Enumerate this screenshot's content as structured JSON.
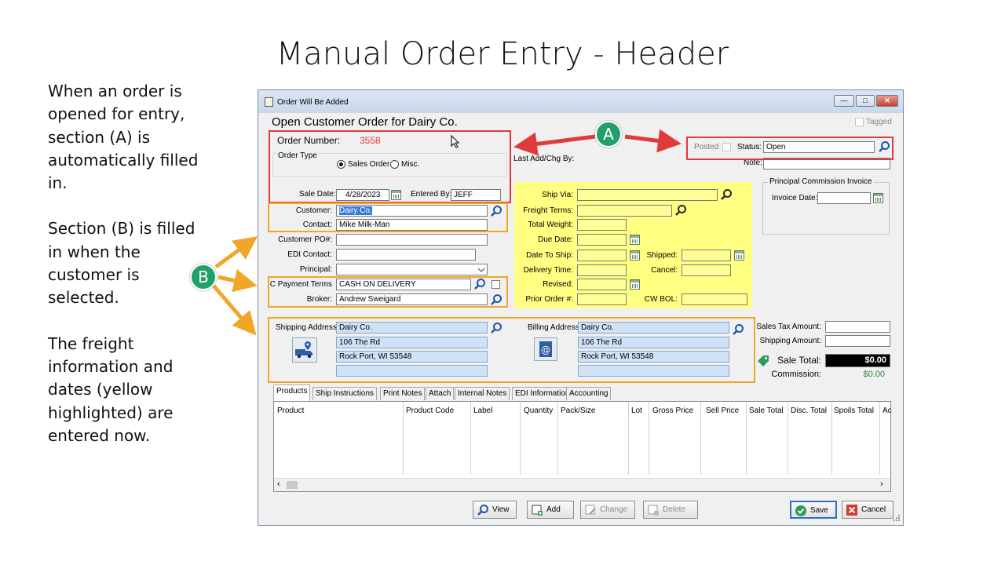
{
  "slide": {
    "title": "Manual Order Entry - Header",
    "paragraphs": [
      "When an order is opened for entry, section (A) is automatically filled in.",
      "Section (B) is filled in when the customer is selected.",
      "The freight information and dates (yellow highlighted) are entered now."
    ]
  },
  "callouts": {
    "a": "A",
    "b": "B"
  },
  "window": {
    "title": "Order Will Be Added",
    "heading": "Open Customer Order for Dairy Co.",
    "tagged_label": "Tagged",
    "order_number_label": "Order Number:",
    "order_number": "3558",
    "order_type_label": "Order Type",
    "sales_order_label": "Sales Order",
    "misc_label": "Misc.",
    "last_add_label": "Last Add/Chg By:",
    "posted_label": "Posted",
    "status_label": "Status:",
    "status_value": "Open",
    "note_label": "Note:",
    "note_value": "",
    "sale_date_label": "Sale Date:",
    "sale_date": "4/28/2023",
    "entered_by_label": "Entered By:",
    "entered_by": "JEFF",
    "customer_label": "Customer:",
    "customer": "Dairy Co.",
    "contact_label": "Contact:",
    "contact": "Mike Milk-Man",
    "customer_po_label": "Customer PO#:",
    "customer_po": "",
    "edi_contact_label": "EDI Contact:",
    "edi_contact": "",
    "principal_label": "Principal:",
    "principal": "",
    "payment_terms_label": "C Payment Terms",
    "payment_terms": "CASH ON DELIVERY",
    "broker_label": "Broker:",
    "broker": "Andrew Sweigard",
    "ship_via_label": "Ship Via:",
    "freight_terms_label": "Freight Terms:",
    "total_weight_label": "Total Weight:",
    "due_date_label": "Due Date:",
    "date_to_ship_label": "Date To Ship:",
    "shipped_label": "Shipped:",
    "delivery_time_label": "Delivery Time:",
    "cancel_label": "Cancel:",
    "revised_label": "Revised:",
    "prior_order_label": "Prior Order #:",
    "cw_bol_label": "CW BOL:",
    "principal_commission_label": "Principal Commission Invoice",
    "invoice_date_label": "Invoice Date:",
    "shipping_address_label": "Shipping Address:",
    "shipping_address": [
      "Dairy Co.",
      "106 The Rd",
      "Rock Port, WI 53548",
      ""
    ],
    "billing_address_label": "Billing Address:",
    "billing_address": [
      "Dairy Co.",
      "106 The Rd",
      "Rock Port, WI 53548",
      ""
    ],
    "sales_tax_label": "Sales Tax Amount:",
    "shipping_amount_label": "Shipping Amount:",
    "sale_total_label": "Sale Total:",
    "sale_total": "$0.00",
    "commission_label": "Commission:",
    "commission": "$0.00"
  },
  "tabs": [
    "Products",
    "Ship Instructions",
    "Print Notes",
    "Attach",
    "Internal Notes",
    "EDI Information",
    "Accounting"
  ],
  "grid_columns": [
    "Product",
    "Product Code",
    "Label",
    "Quantity",
    "Pack/Size",
    "Lot",
    "Gross Price",
    "Sell Price",
    "Sale Total",
    "Disc. Total",
    "Spoils Total",
    "Ac"
  ],
  "buttons": {
    "view": "View",
    "add": "Add",
    "change": "Change",
    "delete": "Delete",
    "save": "Save",
    "cancel": "Cancel"
  },
  "colors": {
    "callout": "#22a06b",
    "red_box": "#e03b3b",
    "orange_box": "#f1a628",
    "yellow_fields": "#ffff82",
    "order_number": "#e03b3b",
    "commission": "#2e8b3a"
  }
}
